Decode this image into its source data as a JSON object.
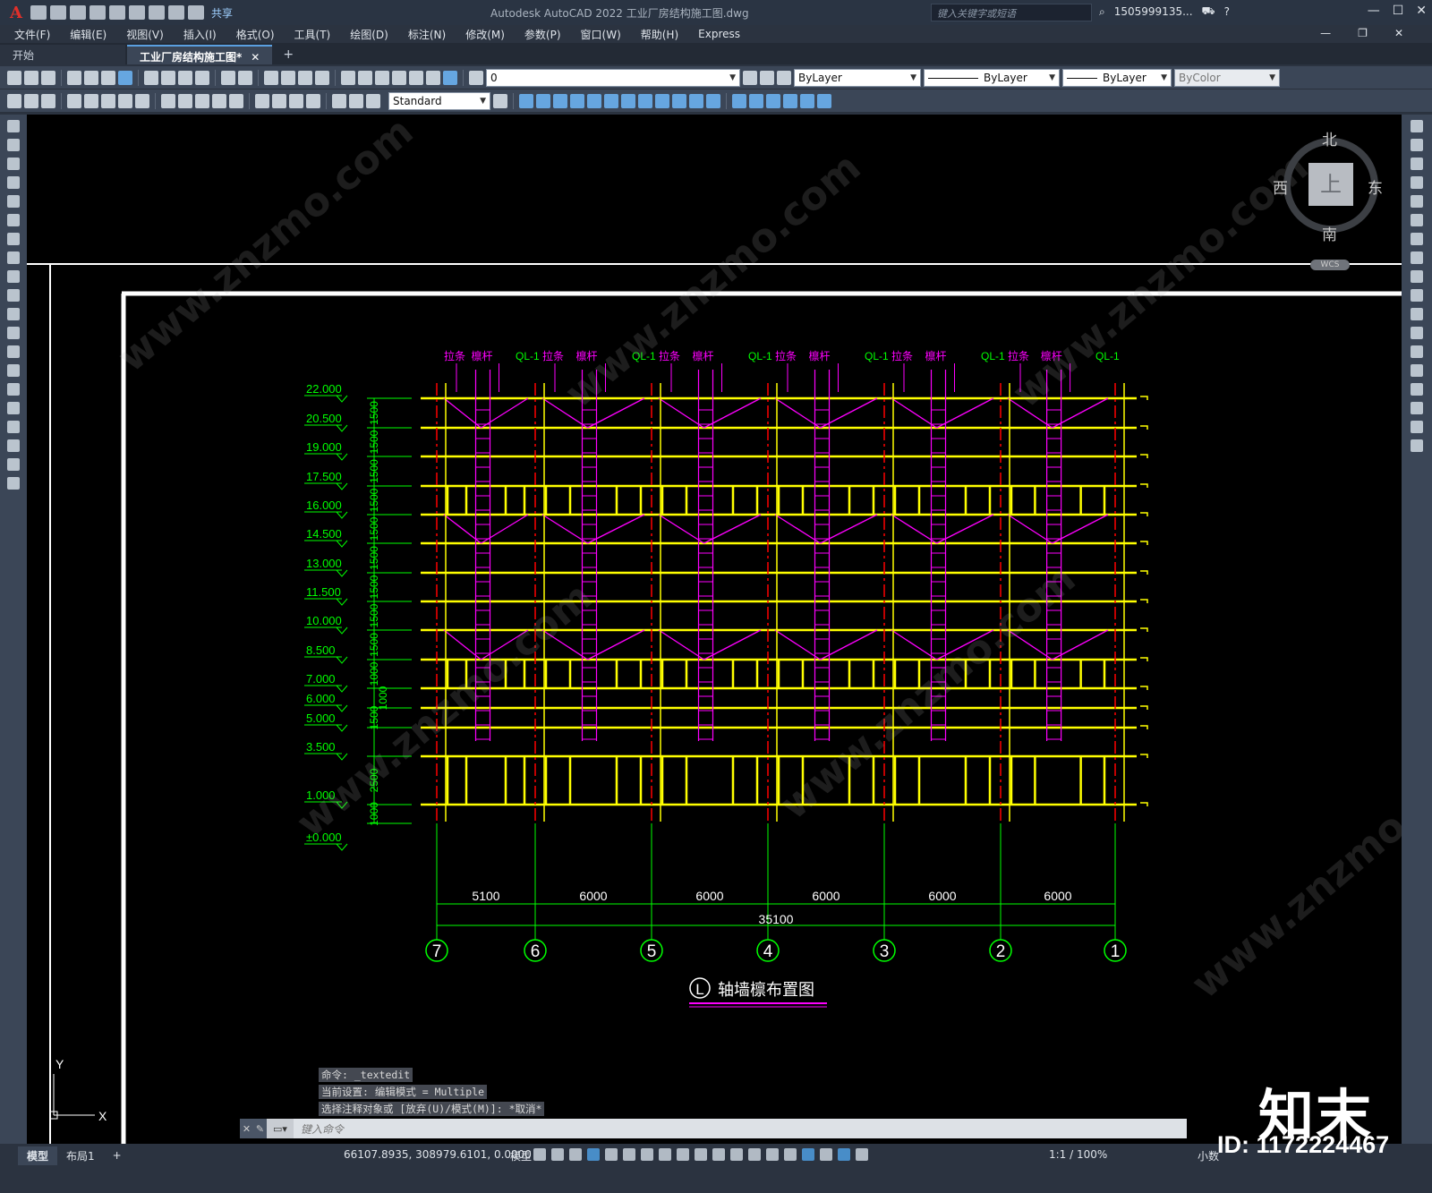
{
  "app": {
    "title": "Autodesk AutoCAD 2022    工业厂房结构施工图.dwg",
    "icon_letter": "A",
    "share_label": "共享",
    "search_placeholder": "键入关键字或短语",
    "user": "1505999135...",
    "window_controls": [
      "—",
      "☐",
      "✕"
    ]
  },
  "menu": [
    "文件(F)",
    "编辑(E)",
    "视图(V)",
    "插入(I)",
    "格式(O)",
    "工具(T)",
    "绘图(D)",
    "标注(N)",
    "修改(M)",
    "参数(P)",
    "窗口(W)",
    "帮助(H)",
    "Express"
  ],
  "tabs": [
    {
      "label": "开始",
      "active": false
    },
    {
      "label": "工业厂房结构施工图*",
      "active": true
    }
  ],
  "toolbar": {
    "layer_value": "0",
    "color_value": "ByLayer",
    "linetype_value": "ByLayer",
    "lineweight_value": "ByLayer",
    "plotstyle_value": "ByColor",
    "textstyle_value": "Standard"
  },
  "viewcube": {
    "north": "北",
    "south": "南",
    "east": "东",
    "west": "西",
    "face": "上",
    "wcs": "WCS"
  },
  "drawing": {
    "top_labels": [
      "拉条",
      "檩杆",
      "QL-1",
      "拉条",
      "檩杆",
      "QL-1",
      "拉条",
      "檩杆",
      "QL-1",
      "拉条",
      "檩杆",
      "QL-1",
      "拉条",
      "檩杆",
      "QL-1",
      "拉条",
      "檩杆",
      "QL-1"
    ],
    "elevations": [
      "22.000",
      "20.500",
      "19.000",
      "17.500",
      "16.000",
      "14.500",
      "13.000",
      "11.500",
      "10.000",
      "8.500",
      "7.000",
      "6.000",
      "5.000",
      "3.500",
      "1.000",
      "±0.000"
    ],
    "vertical_dims": [
      "1500",
      "1500",
      "1500",
      "1500",
      "1500",
      "1500",
      "1500",
      "1500",
      "1500",
      "1000",
      "1000",
      "1500",
      "2500",
      "1000"
    ],
    "bay_dims": [
      "5100",
      "6000",
      "6000",
      "6000",
      "6000",
      "6000"
    ],
    "total_dim": "35100",
    "axes": [
      "7",
      "6",
      "5",
      "4",
      "3",
      "2",
      "1"
    ],
    "title_axis": "L",
    "title_text": "轴墙檩布置图",
    "ucs_x": "X",
    "ucs_y": "Y"
  },
  "command": {
    "history": [
      "命令: _textedit",
      "当前设置: 编辑模式 = Multiple",
      "选择注释对象或 [放弃(U)/模式(M)]: *取消*"
    ],
    "placeholder": "键入命令"
  },
  "status": {
    "tabs": [
      "模型",
      "布局1"
    ],
    "coords": "66107.8935, 308979.6101, 0.0000",
    "mode": "模型",
    "scale": "1:1 / 100%",
    "units": "小数"
  },
  "watermark": {
    "logo": "知末",
    "id": "ID: 1172224467"
  },
  "colors": {
    "canvas": "#000000",
    "yellow": "#ffff00",
    "magenta": "#ff00ff",
    "green": "#00ff00",
    "red": "#ff0000"
  }
}
